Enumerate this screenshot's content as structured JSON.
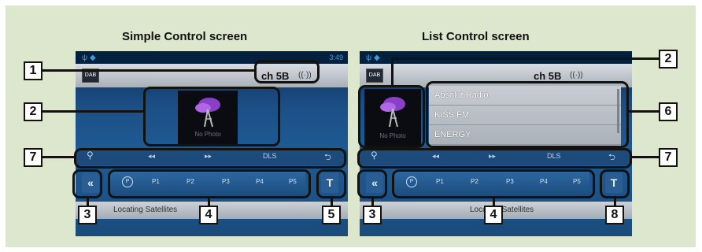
{
  "colors": {
    "background": "#dde7cd",
    "callout": "#13120f",
    "screen_blue": "#1f5b94"
  },
  "left_screen": {
    "title": "Simple Control screen",
    "time": "3:49",
    "channel": "ch 5B",
    "artwork_label": "No Photo",
    "controls": {
      "search": "search-icon",
      "rewind": "◂◂",
      "forward": "▸▸",
      "dls": "DLS",
      "repeat": "repeat-icon"
    },
    "back_button": "«",
    "preset_p": "P",
    "presets": [
      "P1",
      "P2",
      "P3",
      "P4",
      "P5"
    ],
    "tune_button": "T",
    "status_text": "Locating Satellites"
  },
  "right_screen": {
    "title": "List Control screen",
    "channel": "ch 5B",
    "artwork_label": "No Photo",
    "list_items": [
      "Absolut Radio",
      "KISS FM",
      "ENERGY"
    ],
    "controls": {
      "search": "search-icon",
      "rewind": "◂◂",
      "forward": "▸▸",
      "dls": "DLS",
      "repeat": "repeat-icon"
    },
    "back_button": "«",
    "preset_p": "P",
    "presets": [
      "P1",
      "P2",
      "P3",
      "P4",
      "P5"
    ],
    "tune_button": "T",
    "status_text": "Locating Satellites"
  },
  "callouts": {
    "c1": "1",
    "c2": "2",
    "c3": "3",
    "c4": "4",
    "c5": "5",
    "c6": "6",
    "c7": "7",
    "c8": "8"
  }
}
